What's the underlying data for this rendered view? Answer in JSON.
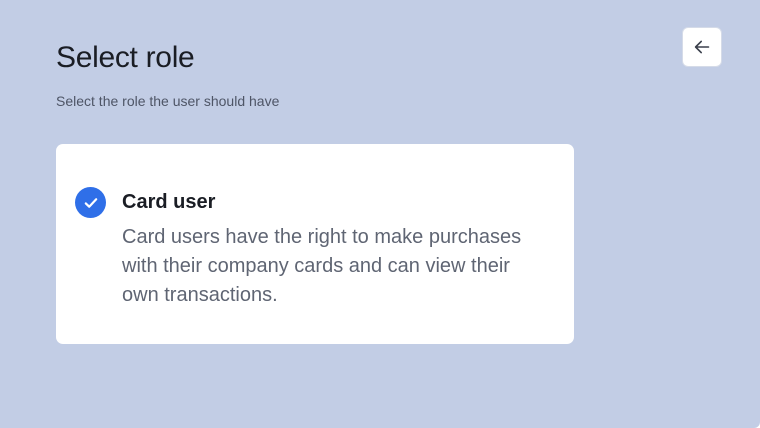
{
  "header": {
    "title": "Select role",
    "subtitle": "Select the role the user should have"
  },
  "back_button": {
    "icon": "arrow-left-icon"
  },
  "roles": [
    {
      "name": "Card user",
      "description": "Card users have the right to make purchases with their company cards and can view their own transactions.",
      "selected": true
    }
  ],
  "colors": {
    "background": "#c2cde5",
    "card": "#ffffff",
    "accent": "#2f6fe8",
    "title_text": "#1a1d24",
    "muted_text": "#5f6573"
  }
}
